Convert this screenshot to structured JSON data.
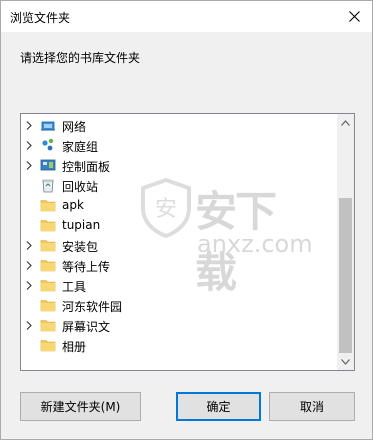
{
  "window": {
    "title": "浏览文件夹"
  },
  "instruction": "请选择您的书库文件夹",
  "tree": {
    "items": [
      {
        "label": "网络",
        "icon": "network-icon",
        "expandable": true
      },
      {
        "label": "家庭组",
        "icon": "homegroup-icon",
        "expandable": true
      },
      {
        "label": "控制面板",
        "icon": "control-panel-icon",
        "expandable": true
      },
      {
        "label": "回收站",
        "icon": "recycle-bin-icon",
        "expandable": false
      },
      {
        "label": "apk",
        "icon": "folder-icon",
        "expandable": false
      },
      {
        "label": "tupian",
        "icon": "folder-icon",
        "expandable": false
      },
      {
        "label": "安装包",
        "icon": "folder-icon",
        "expandable": true
      },
      {
        "label": "等待上传",
        "icon": "folder-icon",
        "expandable": true
      },
      {
        "label": "工具",
        "icon": "folder-icon",
        "expandable": true
      },
      {
        "label": "河东软件园",
        "icon": "folder-icon",
        "expandable": false
      },
      {
        "label": "屏幕识文",
        "icon": "folder-icon",
        "expandable": true
      },
      {
        "label": "相册",
        "icon": "folder-icon",
        "expandable": false
      }
    ]
  },
  "buttons": {
    "new_folder": "新建文件夹(M)",
    "ok": "确定",
    "cancel": "取消"
  },
  "watermark": {
    "text": "安下载",
    "sub": "anxz.com"
  },
  "colors": {
    "folder": "#f5c85a",
    "focus_border": "#0078d7"
  }
}
